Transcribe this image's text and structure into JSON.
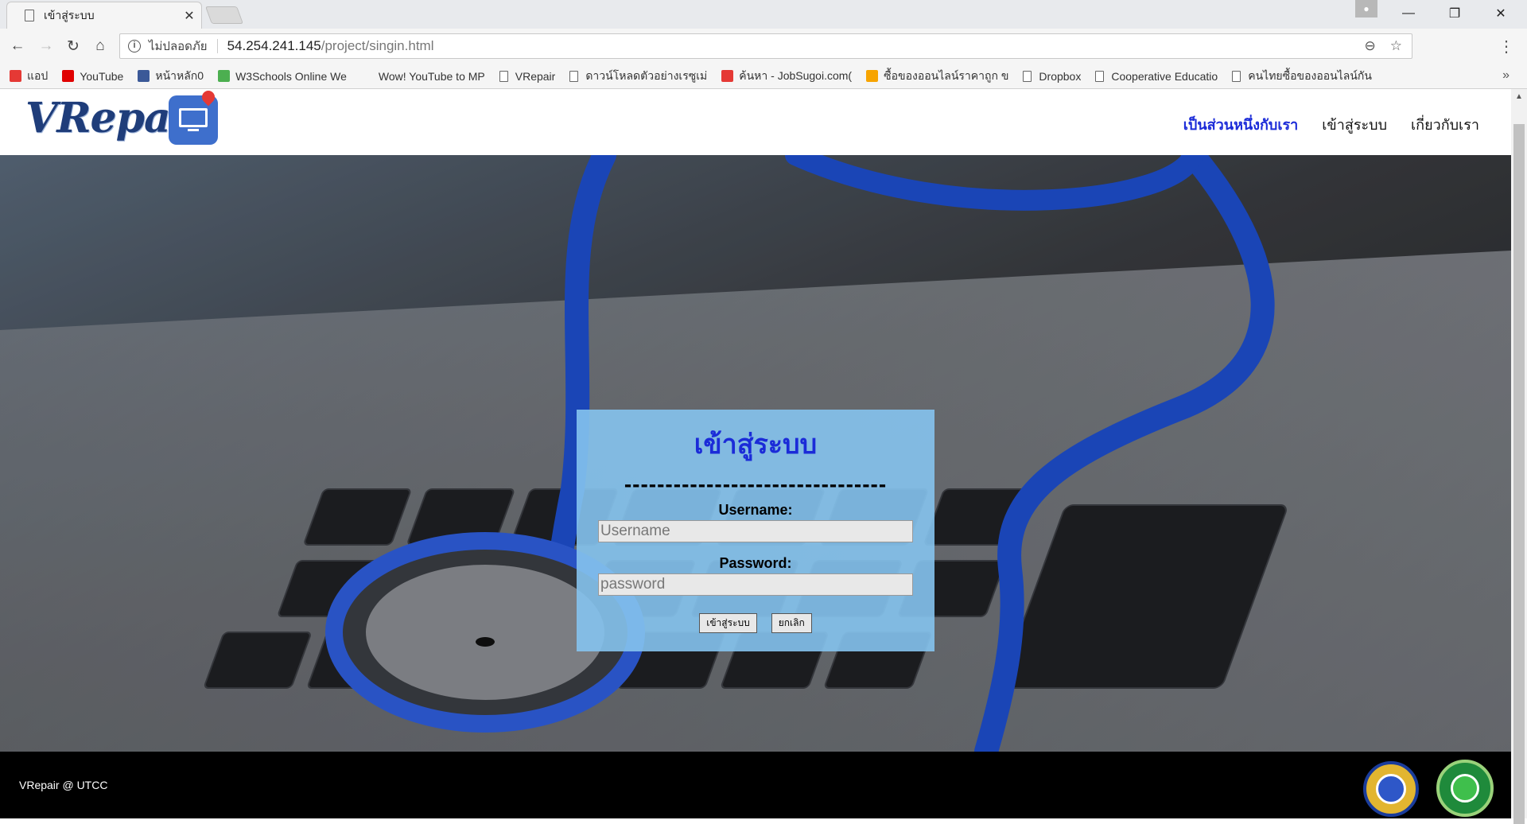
{
  "browser": {
    "tab_title": "เข้าสู่ระบบ",
    "address": {
      "security_label": "ไม่ปลอดภัย",
      "host": "54.254.241.145",
      "path": "/project/singin.html"
    },
    "bookmarks": [
      {
        "label": "แอป",
        "icon": "apps-grid-icon",
        "color": "#e53935"
      },
      {
        "label": "YouTube",
        "icon": "youtube-icon",
        "color": "#e00000"
      },
      {
        "label": "หน้าหลัก0",
        "icon": "facebook-icon",
        "color": "#3b5998"
      },
      {
        "label": "W3Schools Online We",
        "icon": "w3schools-icon",
        "color": "#4caf50"
      },
      {
        "label": "Wow! YouTube to MP",
        "icon": "blank-icon",
        "color": "#f5f5f5"
      },
      {
        "label": "VRepair",
        "icon": "document-icon",
        "color": ""
      },
      {
        "label": "ดาวน์โหลดตัวอย่างเรซูเม่",
        "icon": "document-icon",
        "color": ""
      },
      {
        "label": "ค้นหา - JobSugoi.com(",
        "icon": "jobsugoi-icon",
        "color": "#e53935"
      },
      {
        "label": "ซื้อของออนไลน์ราคาถูก ข",
        "icon": "shop-icon",
        "color": "#f7a400"
      },
      {
        "label": "Dropbox",
        "icon": "document-icon",
        "color": ""
      },
      {
        "label": "Cooperative Educatio",
        "icon": "document-icon",
        "color": ""
      },
      {
        "label": "คนไทยซื้อของออนไลน์กัน",
        "icon": "document-icon",
        "color": ""
      }
    ]
  },
  "site": {
    "logo_text": "VRepair",
    "nav": [
      {
        "label": "เป็นส่วนหนึ่งกับเรา",
        "active": true
      },
      {
        "label": "เข้าสู่ระบบ",
        "active": false
      },
      {
        "label": "เกี่ยวกับเรา",
        "active": false
      }
    ]
  },
  "login": {
    "title": "เข้าสู่ระบบ",
    "divider": "--------------------------------",
    "username_label": "Username:",
    "username_placeholder": "Username",
    "password_label": "Password:",
    "password_placeholder": "password",
    "submit_label": "เข้าสู่ระบบ",
    "cancel_label": "ยกเลิก"
  },
  "footer": {
    "text": "VRepair @ UTCC"
  },
  "colors": {
    "accent": "#1b2bd8",
    "panel": "#85c3ee",
    "footer": "#000000"
  }
}
